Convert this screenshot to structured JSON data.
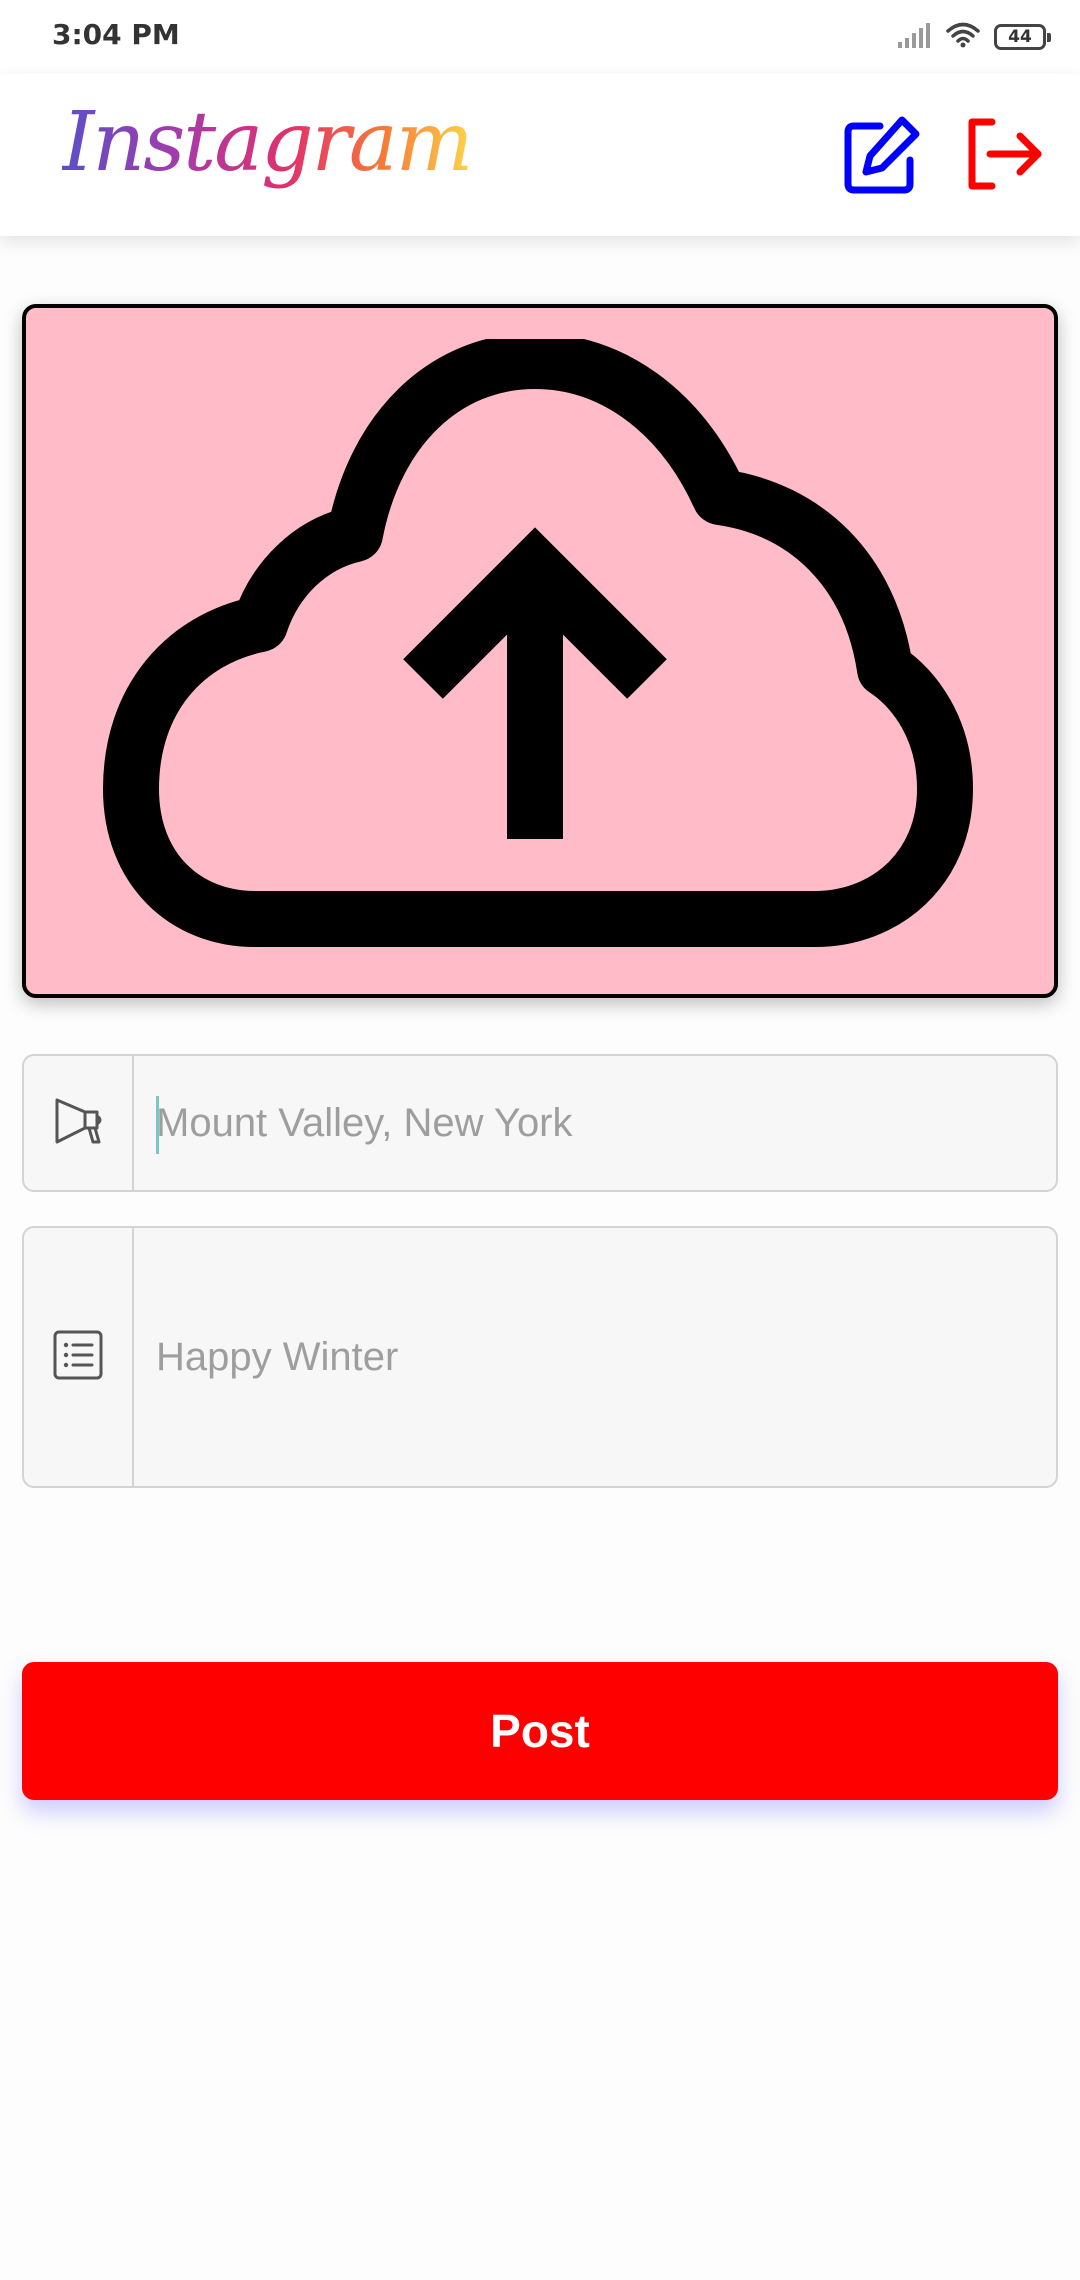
{
  "status_bar": {
    "time": "3:04 PM",
    "battery": "44",
    "icons": [
      "signal-icon",
      "wifi-icon",
      "battery-icon"
    ]
  },
  "app_bar": {
    "logo": "Instagram",
    "actions": [
      {
        "name": "edit-icon",
        "color": "#0000ff"
      },
      {
        "name": "logout-icon",
        "color": "#ff0000"
      }
    ]
  },
  "upload": {
    "icon": "cloud-upload-icon",
    "background": "#ffbcc8"
  },
  "form": {
    "location_placeholder": "Mount Valley, New York",
    "location_value": "",
    "location_icon": "megaphone-icon",
    "caption_placeholder": "Happy Winter",
    "caption_value": "",
    "caption_icon": "list-icon"
  },
  "post_button": {
    "label": "Post",
    "color": "#ff0000"
  }
}
